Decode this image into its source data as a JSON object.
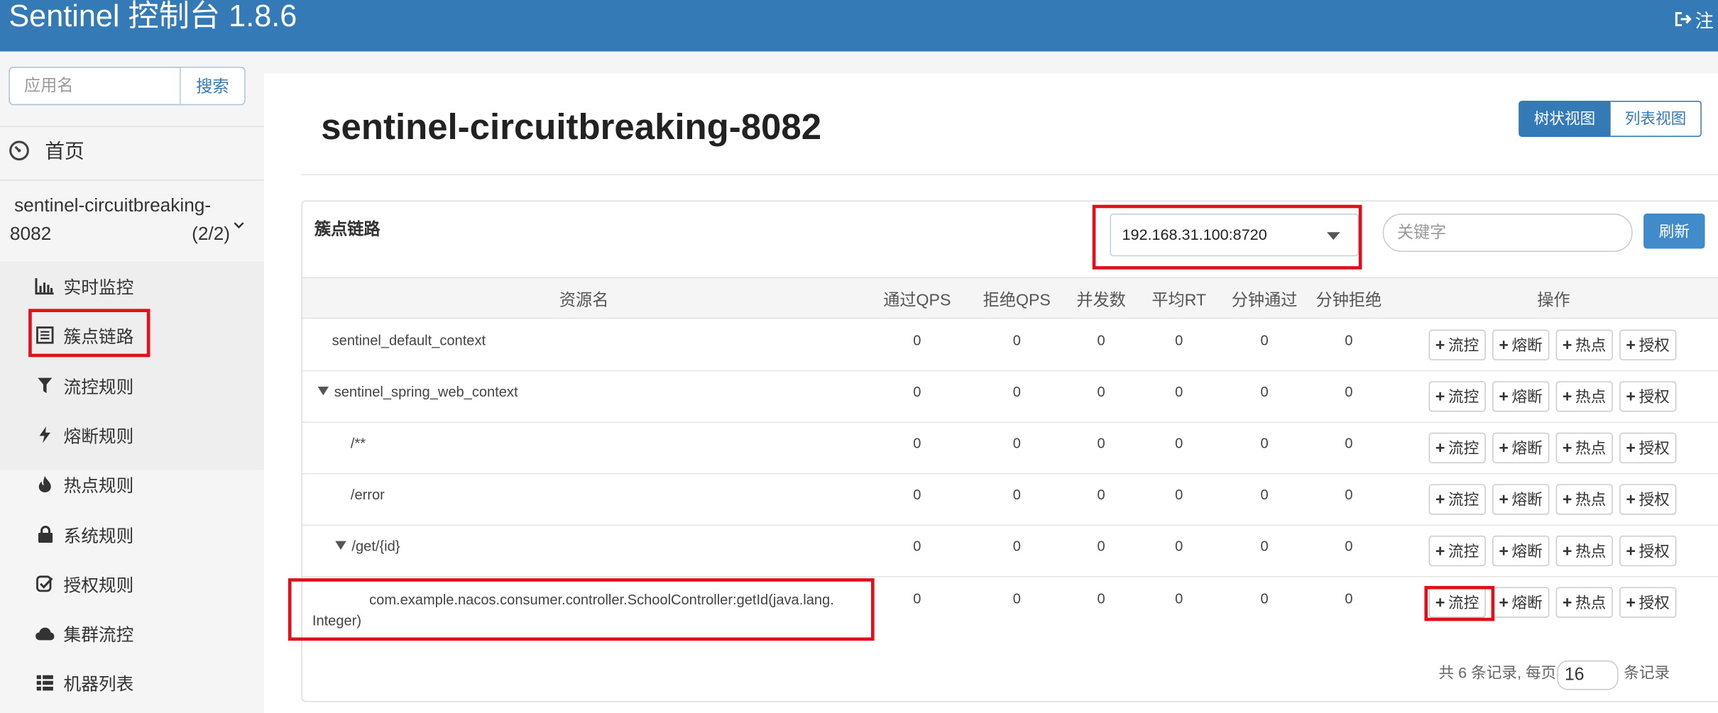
{
  "header": {
    "brand": "Sentinel 控制台 1.8.6",
    "logout_label": "注"
  },
  "sidebar": {
    "search_placeholder": "应用名",
    "search_button": "搜索",
    "home_label": "首页",
    "app_name_line1": "sentinel-circuitbreaking-",
    "app_name_line2": "8082",
    "app_count": "(2/2)",
    "menu": [
      {
        "label": "实时监控",
        "icon": "bar-chart-icon"
      },
      {
        "label": "簇点链路",
        "icon": "list-alt-icon"
      },
      {
        "label": "流控规则",
        "icon": "filter-icon"
      },
      {
        "label": "熔断规则",
        "icon": "flash-icon"
      },
      {
        "label": "热点规则",
        "icon": "fire-icon"
      },
      {
        "label": "系统规则",
        "icon": "lock-icon"
      },
      {
        "label": "授权规则",
        "icon": "check-icon"
      },
      {
        "label": "集群流控",
        "icon": "cloud-icon"
      },
      {
        "label": "机器列表",
        "icon": "th-list-icon"
      }
    ]
  },
  "main": {
    "title": "sentinel-circuitbreaking-8082",
    "view_tree": "树状视图",
    "view_list": "列表视图",
    "panel_title": "簇点链路",
    "machine_select": "192.168.31.100:8720",
    "keyword_placeholder": "关键字",
    "refresh_button": "刷新"
  },
  "table": {
    "columns": [
      "资源名",
      "通过QPS",
      "拒绝QPS",
      "并发数",
      "平均RT",
      "分钟通过",
      "分钟拒绝",
      "操作"
    ],
    "rows": [
      {
        "name": "sentinel_default_context",
        "values": [
          "0",
          "0",
          "0",
          "0",
          "0",
          "0"
        ]
      },
      {
        "name": "sentinel_spring_web_context",
        "values": [
          "0",
          "0",
          "0",
          "0",
          "0",
          "0"
        ]
      },
      {
        "name": "/**",
        "values": [
          "0",
          "0",
          "0",
          "0",
          "0",
          "0"
        ]
      },
      {
        "name": "/error",
        "values": [
          "0",
          "0",
          "0",
          "0",
          "0",
          "0"
        ]
      },
      {
        "name": "/get/{id}",
        "values": [
          "0",
          "0",
          "0",
          "0",
          "0",
          "0"
        ]
      },
      {
        "name_line1": "com.example.nacos.consumer.controller.SchoolController:getId(java.lang.",
        "name_line2": "Integer)",
        "values": [
          "0",
          "0",
          "0",
          "0",
          "0",
          "0"
        ]
      }
    ],
    "actions": [
      "流控",
      "熔断",
      "热点",
      "授权"
    ]
  },
  "pager": {
    "summary": "共 6 条记录, 每页",
    "page_size": "16",
    "suffix": "条记录"
  }
}
